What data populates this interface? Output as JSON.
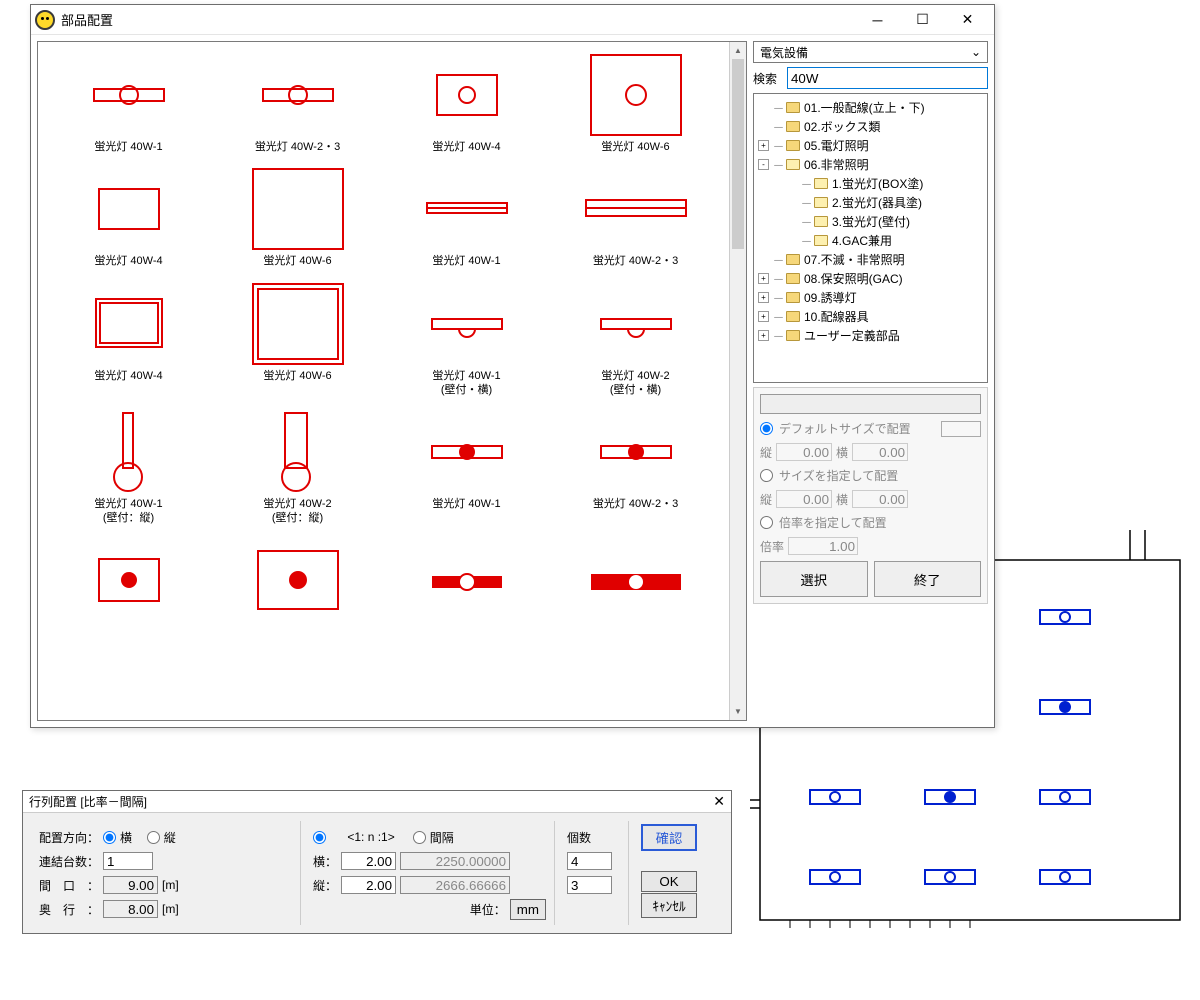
{
  "mainWindow": {
    "title": "部品配置",
    "parts": [
      {
        "label": "蛍光灯 40W-1",
        "shape": "bar-circle"
      },
      {
        "label": "蛍光灯 40W-2・3",
        "shape": "bar-circle"
      },
      {
        "label": "蛍光灯 40W-4",
        "shape": "rect-circle-sm"
      },
      {
        "label": "蛍光灯 40W-6",
        "shape": "rect-circle"
      },
      {
        "label": "蛍光灯 40W-4",
        "shape": "rect-sm"
      },
      {
        "label": "蛍光灯 40W-6",
        "shape": "rect"
      },
      {
        "label": "蛍光灯 40W-1",
        "shape": "dbl-bar"
      },
      {
        "label": "蛍光灯 40W-2・3",
        "shape": "dbl-bar-wide"
      },
      {
        "label": "蛍光灯 40W-4",
        "shape": "dbl-rect-sm"
      },
      {
        "label": "蛍光灯 40W-6",
        "shape": "dbl-rect"
      },
      {
        "label": "蛍光灯 40W-1\n(壁付・横)",
        "shape": "bar-halfcircle"
      },
      {
        "label": "蛍光灯 40W-2\n(壁付・横)",
        "shape": "bar-halfcircle"
      },
      {
        "label": "蛍光灯 40W-1\n(壁付：縦)",
        "shape": "vbar-halfcircle"
      },
      {
        "label": "蛍光灯 40W-2\n(壁付：縦)",
        "shape": "vbar-halfcircle-wide"
      },
      {
        "label": "蛍光灯 40W-1",
        "shape": "bar-fillcircle"
      },
      {
        "label": "蛍光灯 40W-2・3",
        "shape": "bar-fillcircle"
      },
      {
        "label": "",
        "shape": "rect-fillcircle-sm"
      },
      {
        "label": "",
        "shape": "rect-fillcircle"
      },
      {
        "label": "",
        "shape": "bar-circle-fill"
      },
      {
        "label": "",
        "shape": "fillbar-circle"
      }
    ],
    "categoryDropdown": "電気設備",
    "searchLabel": "検索",
    "searchValue": "40W",
    "tree": [
      {
        "indent": 0,
        "exp": "",
        "open": false,
        "label": "01.一般配線(立上・下)"
      },
      {
        "indent": 0,
        "exp": "",
        "open": false,
        "label": "02.ボックス類"
      },
      {
        "indent": 0,
        "exp": "+",
        "open": false,
        "label": "05.電灯照明"
      },
      {
        "indent": 0,
        "exp": "-",
        "open": true,
        "label": "06.非常照明"
      },
      {
        "indent": 1,
        "exp": "",
        "open": true,
        "label": "1.蛍光灯(BOX塗)"
      },
      {
        "indent": 1,
        "exp": "",
        "open": true,
        "label": "2.蛍光灯(器具塗)"
      },
      {
        "indent": 1,
        "exp": "",
        "open": true,
        "label": "3.蛍光灯(壁付)"
      },
      {
        "indent": 1,
        "exp": "",
        "open": true,
        "label": "4.GAC兼用"
      },
      {
        "indent": 0,
        "exp": "",
        "open": false,
        "label": "07.不滅・非常照明"
      },
      {
        "indent": 0,
        "exp": "+",
        "open": false,
        "label": "08.保安照明(GAC)"
      },
      {
        "indent": 0,
        "exp": "+",
        "open": false,
        "label": "09.誘導灯"
      },
      {
        "indent": 0,
        "exp": "+",
        "open": false,
        "label": "10.配線器具"
      },
      {
        "indent": 0,
        "exp": "+",
        "open": false,
        "label": "ユーザー定義部品"
      }
    ],
    "sizeSection": {
      "opt1Label": "デフォルトサイズで配置",
      "opt1Checked": true,
      "verLabel": "縦",
      "ver1": "0.00",
      "horLabel": "横",
      "hor1": "0.00",
      "opt2Label": "サイズを指定して配置",
      "ver2": "0.00",
      "hor2": "0.00",
      "opt3Label": "倍率を指定して配置",
      "rateLabel": "倍率",
      "rate": "1.00",
      "selectBtn": "選択",
      "exitBtn": "終了"
    }
  },
  "gridWindow": {
    "title": "行列配置 [比率－間隔]",
    "dirLabel": "配置方向：",
    "dirH": "横",
    "dirV": "縦",
    "linkLabel": "連結台数：",
    "linkVal": "1",
    "widthLabel": "間　口　：",
    "widthVal": "9.00",
    "widthUnit": "[m]",
    "depthLabel": "奥　行　：",
    "depthVal": "8.00",
    "depthUnit": "[m]",
    "ratioLabel": "<1: n :1>",
    "spaceLabel": "間隔",
    "hLabel": "横：",
    "hRatio": "2.00",
    "hCalc": "2250.00000",
    "vLabel": "縦：",
    "vRatio": "2.00",
    "vCalc": "2666.66666",
    "unitLabel": "単位：",
    "unitBtn": "mm",
    "countLabel": "個数",
    "countH": "4",
    "countV": "3",
    "confirmBtn": "確認",
    "okBtn": "OK",
    "cancelBtn": "ｷｬﾝｾﾙ"
  }
}
